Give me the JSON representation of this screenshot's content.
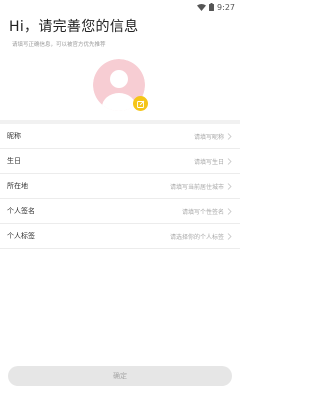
{
  "statusbar": {
    "time": "9:27",
    "wifi_icon": "wifi-icon",
    "battery_icon": "battery-icon"
  },
  "header": {
    "title": "Hi，请完善您的信息",
    "subtitle": "请填写正确信息，可以被官方优先推荐"
  },
  "avatar": {
    "icon": "default-avatar-icon",
    "badge_icon": "edit-icon",
    "badge_color": "#f5c518",
    "avatar_color": "#f7cdd3"
  },
  "form": {
    "rows": [
      {
        "label": "昵称",
        "placeholder": "请填写昵称"
      },
      {
        "label": "生日",
        "placeholder": "请填写生日"
      },
      {
        "label": "所在地",
        "placeholder": "请填写当前居住城市"
      },
      {
        "label": "个人签名",
        "placeholder": "请填写个性签名"
      },
      {
        "label": "个人标签",
        "placeholder": "请选择你的个人标签"
      }
    ]
  },
  "footer": {
    "confirm_label": "确定"
  }
}
